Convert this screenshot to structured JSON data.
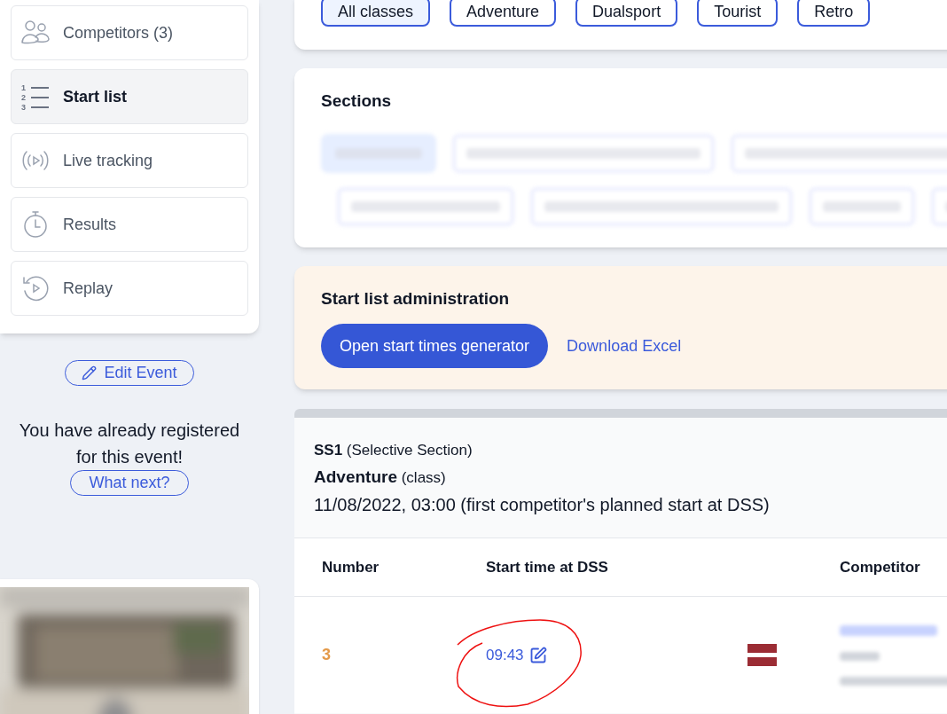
{
  "sidebar": {
    "menu": [
      {
        "label": "Competitors (3)",
        "kind": "people",
        "selected": false
      },
      {
        "label": "Start list",
        "kind": "list",
        "icon_numbers": [
          "1",
          "2",
          "3"
        ],
        "selected": true
      },
      {
        "label": "Live tracking",
        "kind": "live",
        "selected": false
      },
      {
        "label": "Results",
        "kind": "timer",
        "selected": false
      },
      {
        "label": "Replay",
        "kind": "replay",
        "selected": false
      }
    ],
    "edit_button": "Edit Event",
    "registered_text": "You have already registered for this event!",
    "what_next_button": "What next?"
  },
  "classes": [
    {
      "label": "All classes",
      "selected": true
    },
    {
      "label": "Adventure",
      "selected": false
    },
    {
      "label": "Dualsport",
      "selected": false
    },
    {
      "label": "Tourist",
      "selected": false
    },
    {
      "label": "Retro",
      "selected": false
    }
  ],
  "sections": {
    "title": "Sections",
    "chips": [
      {
        "selected": true
      },
      {
        "selected": false
      },
      {
        "selected": false
      },
      {
        "selected": false
      },
      {
        "selected": false
      },
      {
        "selected": false
      },
      {
        "selected": false
      }
    ]
  },
  "administration": {
    "title": "Start list administration",
    "generator_button": "Open start times generator",
    "download_link": "Download Excel"
  },
  "start_list": {
    "section_line": "**SS1** (Selective Section)",
    "class_line": "**Adventure** (class)",
    "date_line": "11/08/2022, 03:00 (first competitor's planned start at DSS)",
    "columns": [
      "Number",
      "Start time at DSS",
      "Competitor"
    ],
    "rows": [
      {
        "number": "3",
        "start_time": "09:43"
      }
    ]
  }
}
